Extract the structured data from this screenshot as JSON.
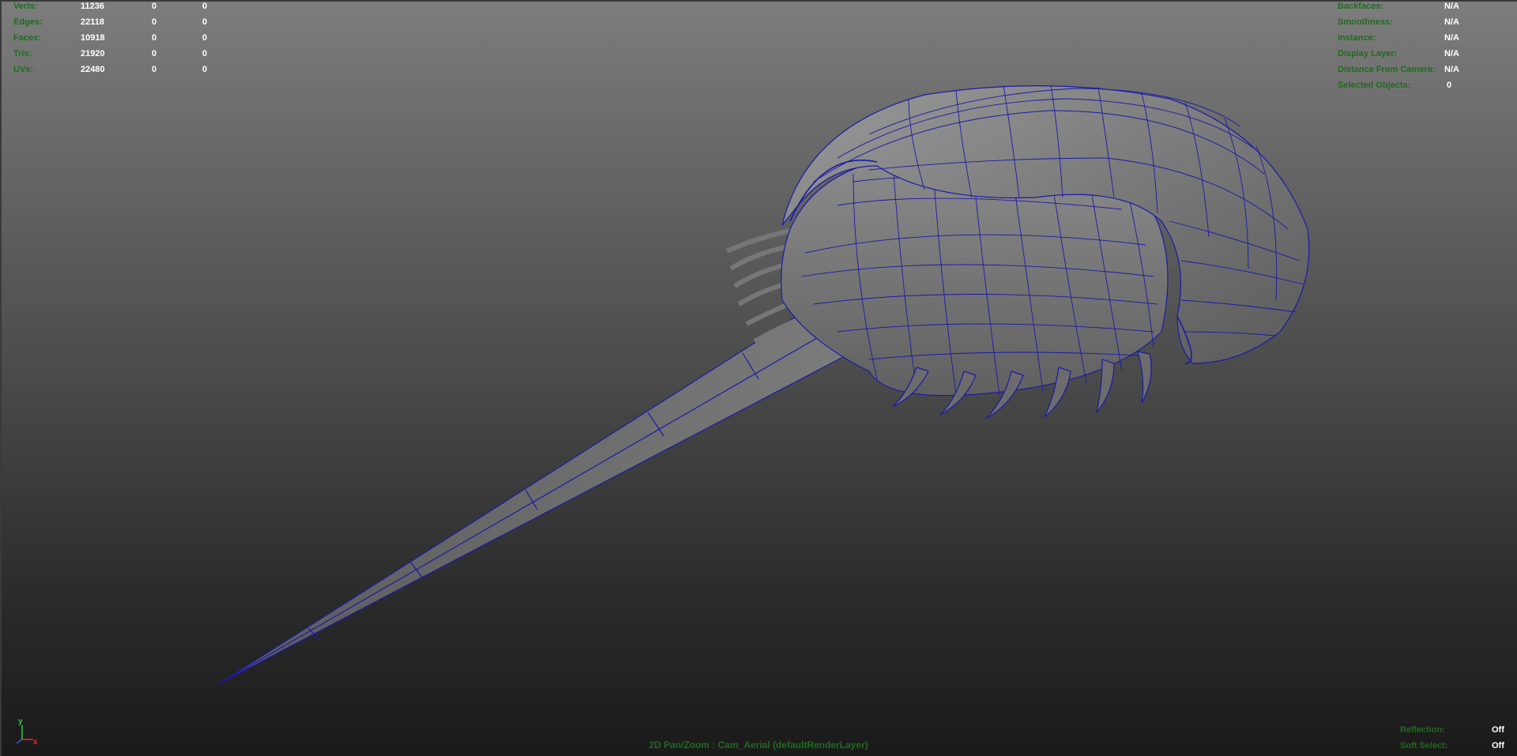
{
  "poly_counts": {
    "rows": [
      {
        "label": "Verts:",
        "total": "11236",
        "selected": "0",
        "triangles": "0"
      },
      {
        "label": "Edges:",
        "total": "22118",
        "selected": "0",
        "triangles": "0"
      },
      {
        "label": "Faces:",
        "total": "10918",
        "selected": "0",
        "triangles": "0"
      },
      {
        "label": "Tris:",
        "total": "21920",
        "selected": "0",
        "triangles": "0"
      },
      {
        "label": "UVs:",
        "total": "22480",
        "selected": "0",
        "triangles": "0"
      }
    ]
  },
  "object_info": {
    "rows": [
      {
        "label": "Backfaces:",
        "value": "N/A"
      },
      {
        "label": "Smoothness:",
        "value": "N/A"
      },
      {
        "label": "Instance:",
        "value": "N/A"
      },
      {
        "label": "Display Layer:",
        "value": "N/A"
      },
      {
        "label": "Distance From Camera:",
        "value": "N/A"
      },
      {
        "label": "Selected Objects:",
        "value": "0"
      }
    ]
  },
  "viewport": {
    "status_text": "2D Pan/Zoom : Cam_Aerial (defaultRenderLayer)",
    "toggles": [
      {
        "label": "Reflection:",
        "value": "Off"
      },
      {
        "label": "Soft Select:",
        "value": "Off"
      }
    ],
    "axis_labels": {
      "y": "y",
      "x": "x"
    },
    "wire_color": "#1a1aa8",
    "hud_color": "#1f6b1f"
  }
}
